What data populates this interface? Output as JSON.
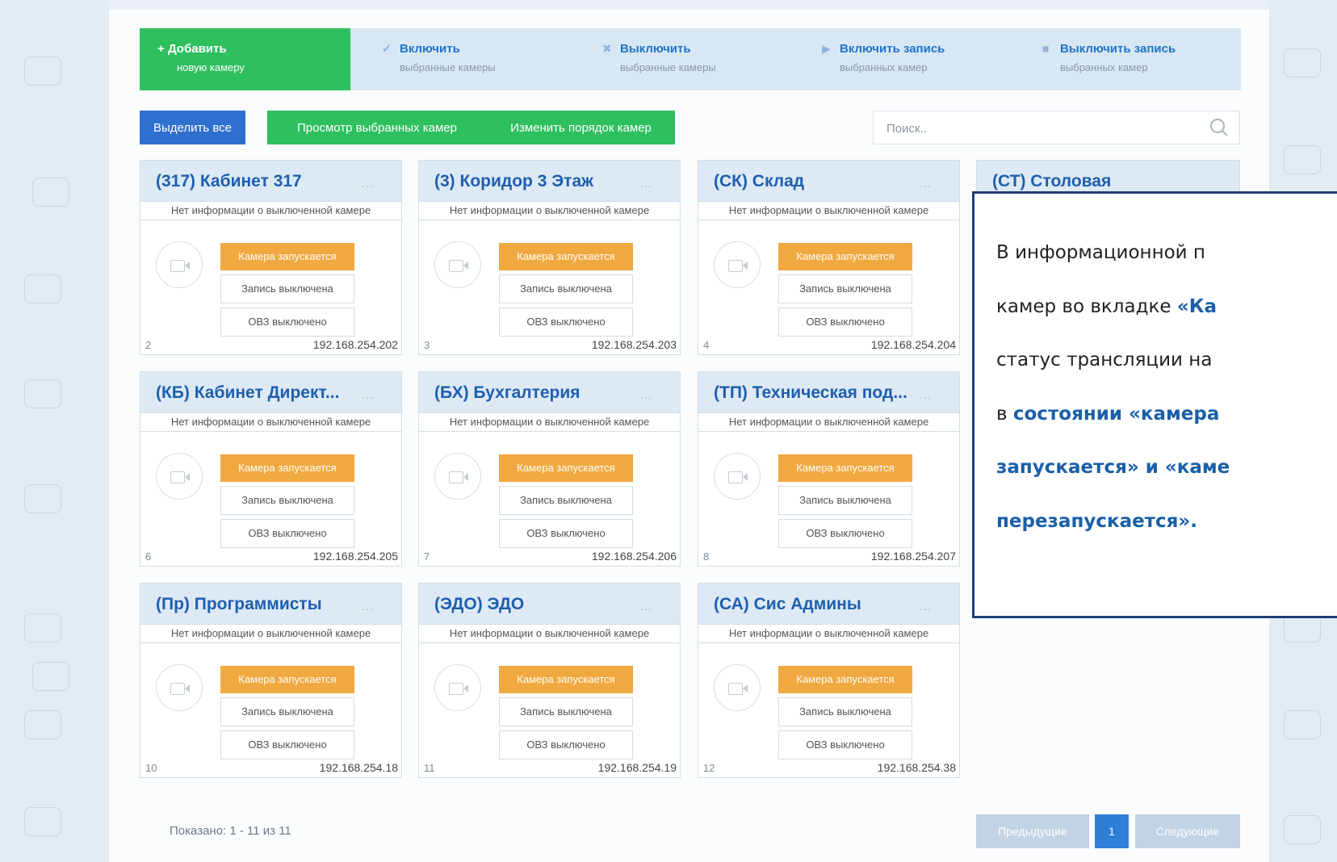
{
  "toolbar": {
    "add": {
      "label": "Добавить",
      "sub": "новую камеру",
      "icon": "plus-icon"
    },
    "items": [
      {
        "icon": "check-icon",
        "glyph": "✔",
        "label": "Включить",
        "sub": "выбранные камеры"
      },
      {
        "icon": "cross-icon",
        "glyph": "✖",
        "label": "Выключить",
        "sub": "выбранные камеры"
      },
      {
        "icon": "play-icon",
        "glyph": "▶",
        "label": "Включить запись",
        "sub": "выбранных камер"
      },
      {
        "icon": "stop-icon",
        "glyph": "■",
        "label": "Выключить запись",
        "sub": "выбранных камер"
      }
    ]
  },
  "actions": {
    "select_all": "Выделить все",
    "view_selected": "Просмотр выбранных камер",
    "reorder": "Изменить порядок камер"
  },
  "search": {
    "placeholder": "Поиск.."
  },
  "card_labels": {
    "no_info": "Нет информации о выключенной камере",
    "status_starting": "Камера запускается",
    "status_recording": "Запись выключена",
    "status_ovz": "ОВЗ выключено",
    "dots": "..."
  },
  "cameras": [
    {
      "title": "(317) Кабинет 317",
      "num": "2",
      "ip": "192.168.254.202"
    },
    {
      "title": "(3) Коридор 3 Этаж",
      "num": "3",
      "ip": "192.168.254.203"
    },
    {
      "title": "(СК) Склад",
      "num": "4",
      "ip": "192.168.254.204"
    },
    {
      "title": "(КБ) Кабинет Директ...",
      "num": "6",
      "ip": "192.168.254.205"
    },
    {
      "title": "(БХ) Бухгалтерия",
      "num": "7",
      "ip": "192.168.254.206"
    },
    {
      "title": "(ТП) Техническая под...",
      "num": "8",
      "ip": "192.168.254.207"
    },
    {
      "title": "(Пр) Программисты",
      "num": "10",
      "ip": "192.168.254.18"
    },
    {
      "title": "(ЭДО) ЭДО",
      "num": "11",
      "ip": "192.168.254.19"
    },
    {
      "title": "(СА) Сис Админы",
      "num": "12",
      "ip": "192.168.254.38"
    }
  ],
  "partial_card": {
    "title": "(СТ) Столовая"
  },
  "footer": {
    "shown": "Показано: 1 - 11 из 11",
    "prev": "Предыдущие",
    "page": "1",
    "next": "Следующие"
  },
  "overlay": {
    "lines": [
      [
        {
          "t": "В информационной п",
          "hl": false
        }
      ],
      [
        {
          "t": "камер во вкладке ",
          "hl": false
        },
        {
          "t": "«Ка",
          "hl": true
        }
      ],
      [
        {
          "t": "статус трансляции на",
          "hl": false
        }
      ],
      [
        {
          "t": "в ",
          "hl": false
        },
        {
          "t": "состоянии «камера",
          "hl": true
        }
      ],
      [
        {
          "t": "запускается» и «каме",
          "hl": true
        }
      ],
      [
        {
          "t": "перезапускается».",
          "hl": true
        }
      ]
    ]
  },
  "colors": {
    "add_green": "#2ebf5f",
    "blue": "#2f6fcf",
    "green": "#2ebf5f",
    "orange": "#f0a940",
    "pager_disabled": "#c3d3e6",
    "pager_active": "#2f7fd8",
    "overlay_border": "#1f3f77"
  }
}
